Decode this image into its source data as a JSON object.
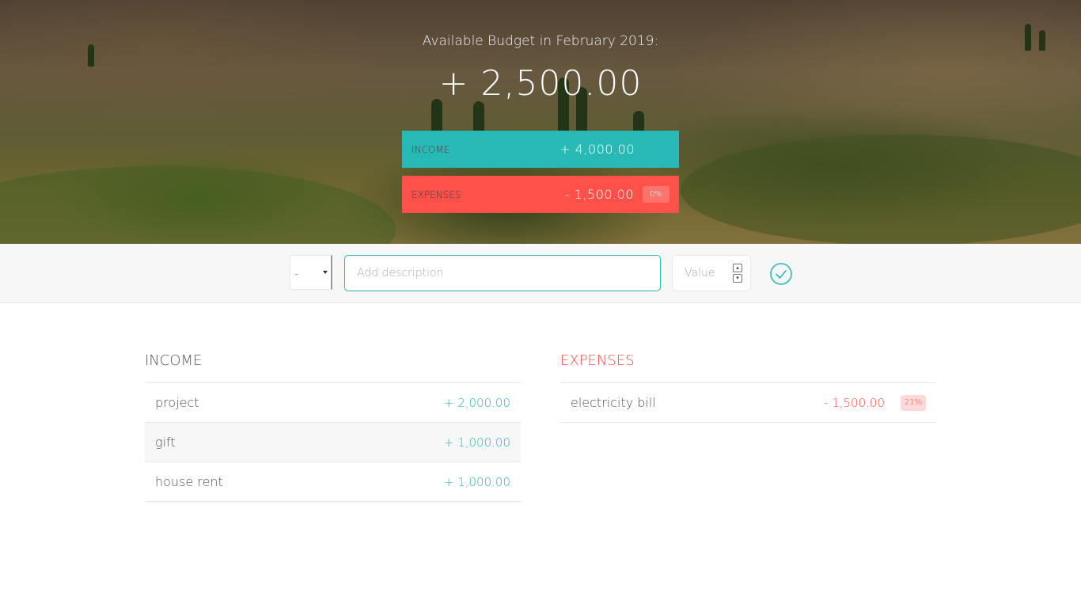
{
  "budget": {
    "title": "Available Budget in February 2019:",
    "value": "+ 2,500.00",
    "income_label": "Income",
    "income_value": "+ 4,000.00",
    "expenses_label": "Expenses",
    "expenses_value": "- 1,500.00",
    "expenses_percentage": "0%"
  },
  "add_form": {
    "type_value": "-",
    "description_placeholder": "Add description",
    "value_placeholder": "Value",
    "submit_icon": "check-circle-icon"
  },
  "income": {
    "title": "Income",
    "items": [
      {
        "description": "project",
        "value": "+ 2,000.00"
      },
      {
        "description": "gift",
        "value": "+ 1,000.00"
      },
      {
        "description": "house rent",
        "value": "+ 1,000.00"
      }
    ]
  },
  "expenses": {
    "title": "Expenses",
    "items": [
      {
        "description": "electricity bill",
        "value": "- 1,500.00",
        "percentage": "21%"
      }
    ]
  },
  "colors": {
    "income": "#28B9B5",
    "expenses": "#FF5049"
  }
}
